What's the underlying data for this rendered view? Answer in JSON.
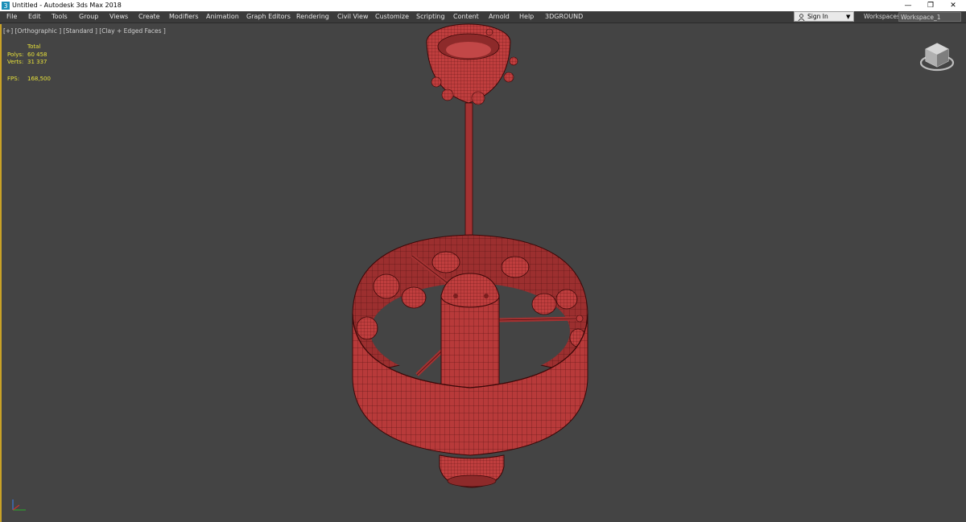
{
  "window": {
    "title": "Untitled - Autodesk 3ds Max 2018",
    "min_glyph": "—",
    "max_glyph": "❐",
    "close_glyph": "✕"
  },
  "menu": {
    "items": [
      "File",
      "Edit",
      "Tools",
      "Group",
      "Views",
      "Create",
      "Modifiers",
      "Animation",
      "Graph Editors",
      "Rendering",
      "Civil View",
      "Customize",
      "Scripting",
      "Content",
      "Arnold",
      "Help",
      "3DGROUND"
    ]
  },
  "account": {
    "sign_in": "Sign In"
  },
  "workspaces": {
    "label": "Workspaces:",
    "value": "Workspace_1"
  },
  "viewport": {
    "label": "[+] [Orthographic ] [Standard ] [Clay + Edged Faces ]",
    "stats": {
      "header": "Total",
      "polys_label": "Polys:",
      "polys_value": "60 458",
      "verts_label": "Verts:",
      "verts_value": "31 337",
      "fps_label": "FPS:",
      "fps_value": "168,500"
    }
  },
  "colors": {
    "viewport_bg": "#444444",
    "model_fill": "#b83a3a",
    "wire": "#4a0d0d",
    "stats_text": "#e8e23a",
    "active_viewport_border": "#c9a227"
  },
  "icons": [
    "app-icon",
    "user-icon",
    "chevron-down-icon",
    "viewcube-icon",
    "axis-tripod-icon"
  ]
}
